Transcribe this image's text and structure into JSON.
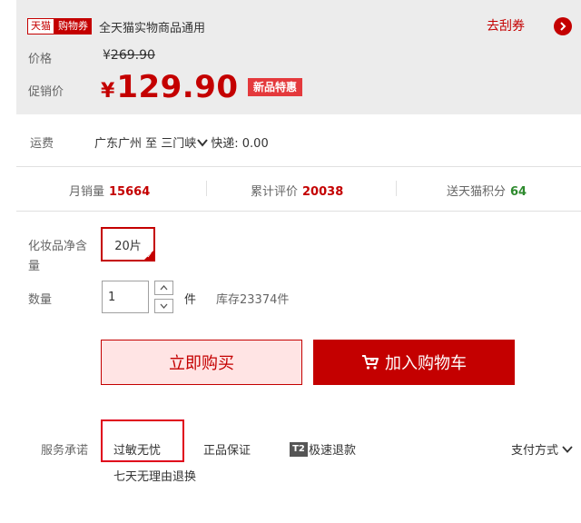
{
  "promo": {
    "tmall_badge": "天猫",
    "coupon_badge": "购物券",
    "text": "全天猫实物商品通用",
    "scratch_link": "去刮券"
  },
  "price": {
    "original_label": "价格",
    "original_currency": "¥",
    "original_value": "269.90",
    "promo_label": "促销价",
    "promo_currency": "¥",
    "promo_value": "129.90",
    "new_badge": "新品特惠"
  },
  "shipping": {
    "label": "运费",
    "route": "广东广州 至 三门峡",
    "method": "快递: 0.00"
  },
  "stats": {
    "sales_label": "月销量",
    "sales_value": "15664",
    "reviews_label": "累计评价",
    "reviews_value": "20038",
    "points_label": "送天猫积分",
    "points_value": "64"
  },
  "options": {
    "sku_label_line1": "化妆品净含",
    "sku_label_line2": "量",
    "sku_selected": "20片",
    "qty_label": "数量",
    "qty_value": "1",
    "qty_unit": "件",
    "stock": "库存23374件"
  },
  "actions": {
    "buy_now": "立即购买",
    "add_to_cart": "加入购物车"
  },
  "services": {
    "label": "服务承诺",
    "items": [
      "过敏无忧",
      "正品保证",
      "极速退款"
    ],
    "t2_tag": "T2",
    "sub_item": "七天无理由退换",
    "payment": "支付方式"
  },
  "colors": {
    "accent": "#c40000",
    "points_green": "#2e8a2e",
    "panel_bg": "#ececec"
  },
  "icons": [
    "chevron-right-icon",
    "chevron-down-icon",
    "caret-up-icon",
    "caret-down-icon",
    "cart-icon",
    "checkmark-icon"
  ]
}
